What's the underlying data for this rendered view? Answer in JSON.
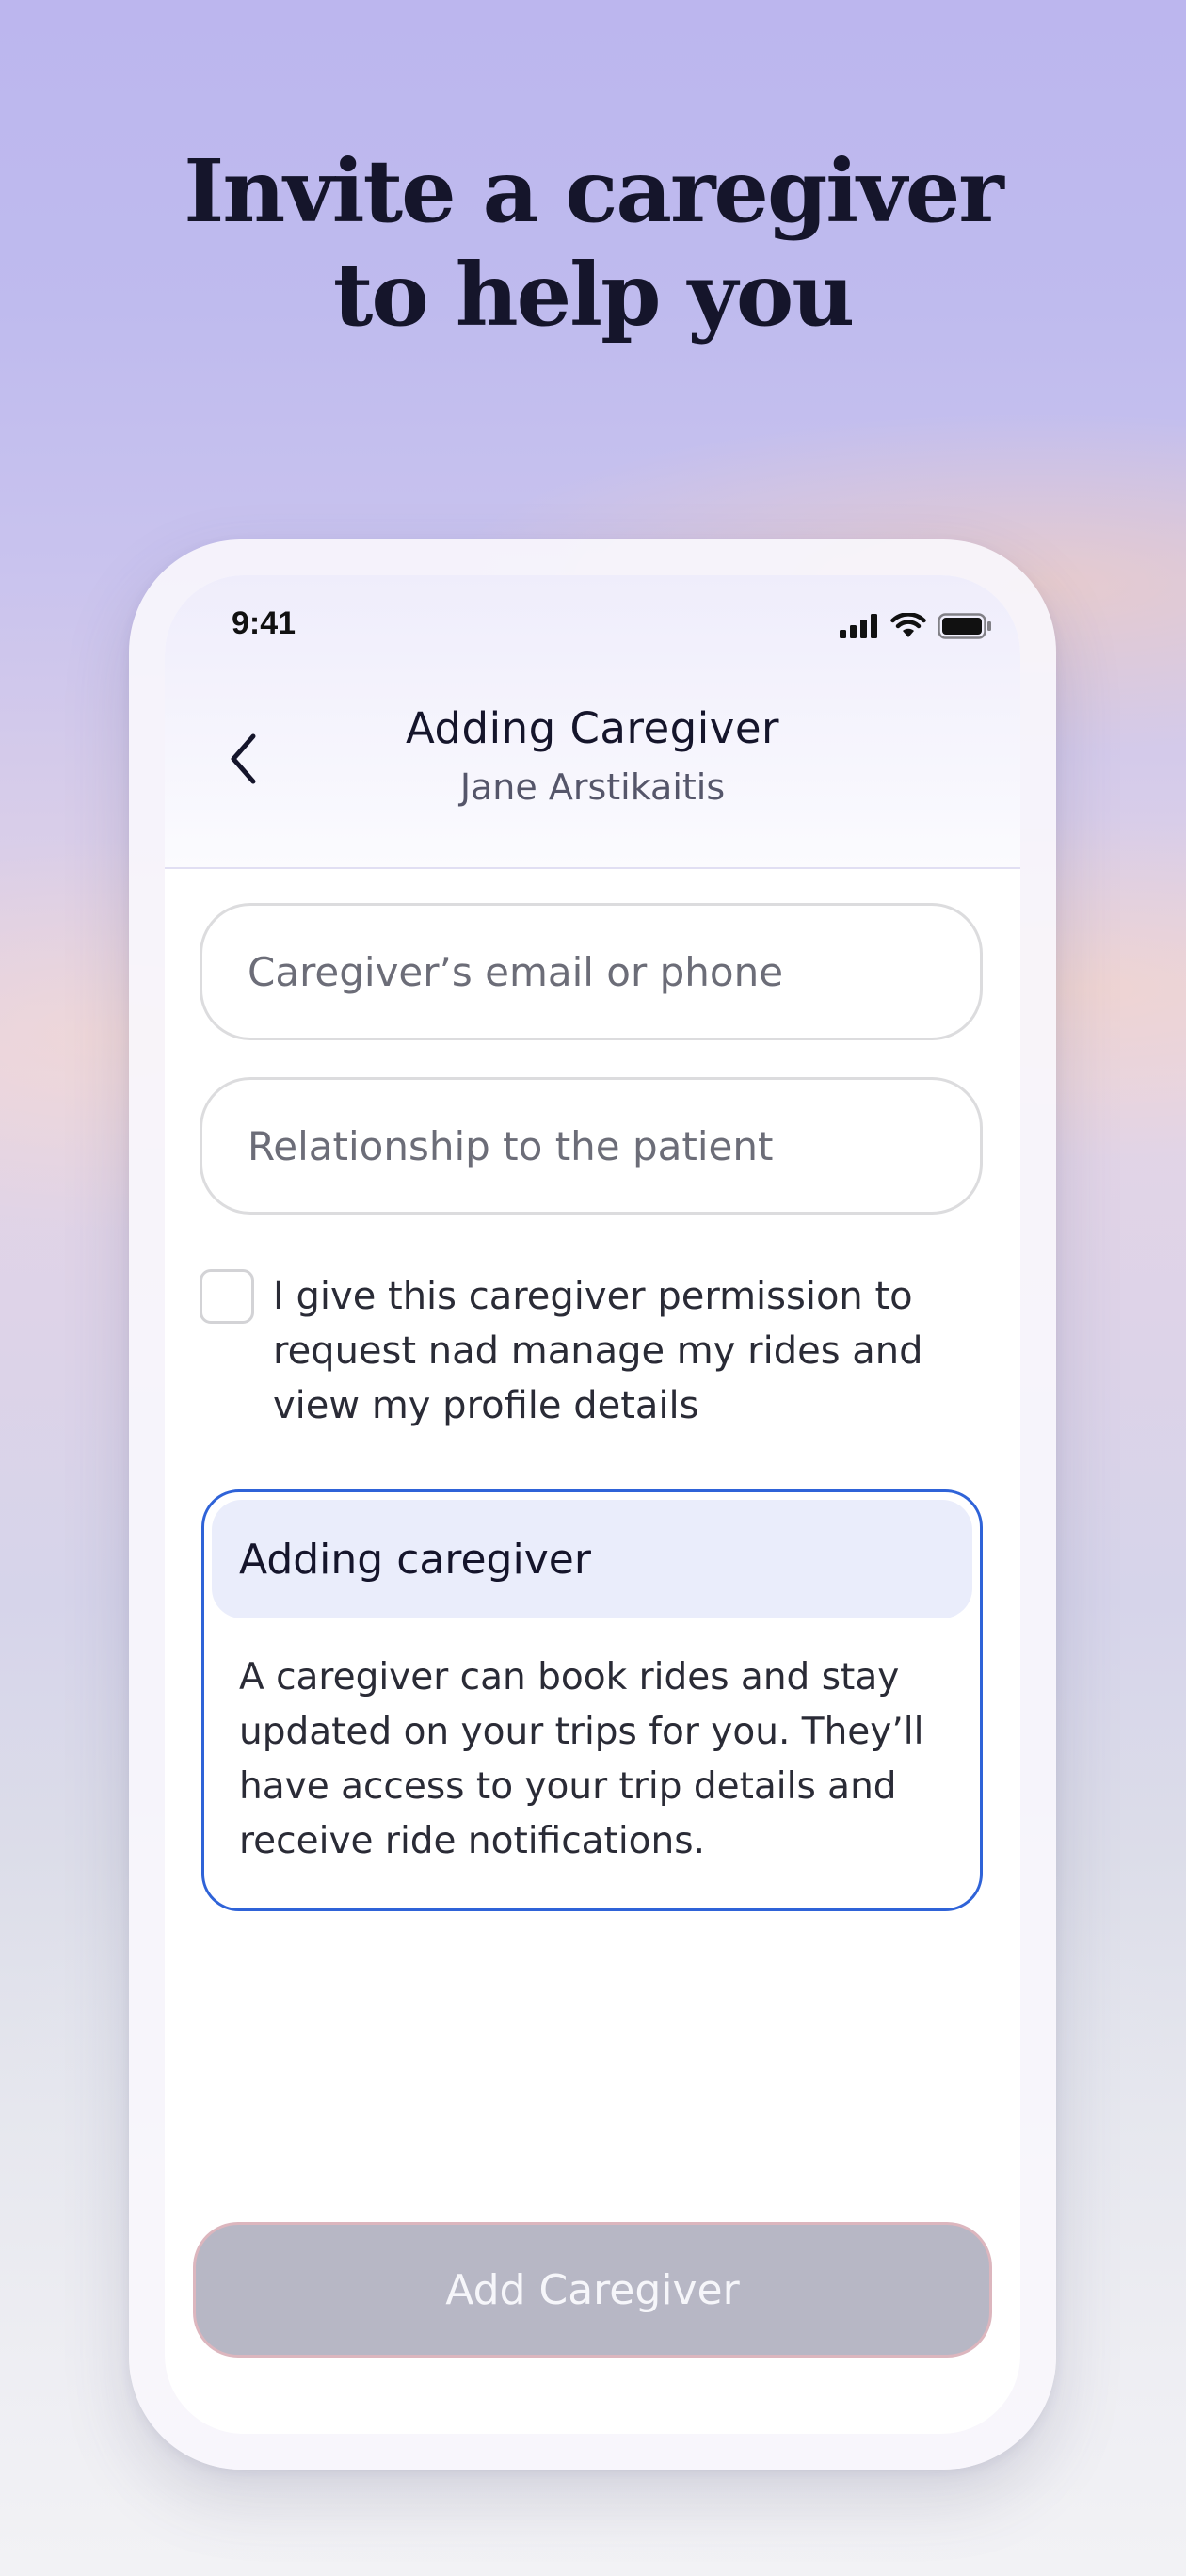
{
  "headline": {
    "line1": "Invite a caregiver",
    "line2": "to help you"
  },
  "status_bar": {
    "time": "9:41",
    "icons": [
      "cellular-signal-icon",
      "wifi-icon",
      "battery-icon"
    ]
  },
  "nav": {
    "back_icon": "chevron-left-icon",
    "title": "Adding Caregiver",
    "subtitle": "Jane Arstikaitis"
  },
  "form": {
    "email_field": {
      "placeholder": "Caregiver’s email or phone",
      "value": ""
    },
    "relationship_field": {
      "placeholder": "Relationship to the patient",
      "value": ""
    },
    "consent": {
      "checked": false,
      "label": "I give this caregiver permission to request nad manage my rides and view my profile details"
    }
  },
  "info_card": {
    "title": "Adding caregiver",
    "body": "A caregiver can book rides and stay updated on your trips for you. They’ll have access to your trip details and receive ride notifications."
  },
  "primary_button": {
    "label": "Add Caregiver",
    "enabled": false
  },
  "colors": {
    "headline_text": "#15152b",
    "accent_border": "#2f63d8",
    "info_header_bg": "#eaedfb",
    "disabled_button_bg": "#b7b7c5"
  }
}
